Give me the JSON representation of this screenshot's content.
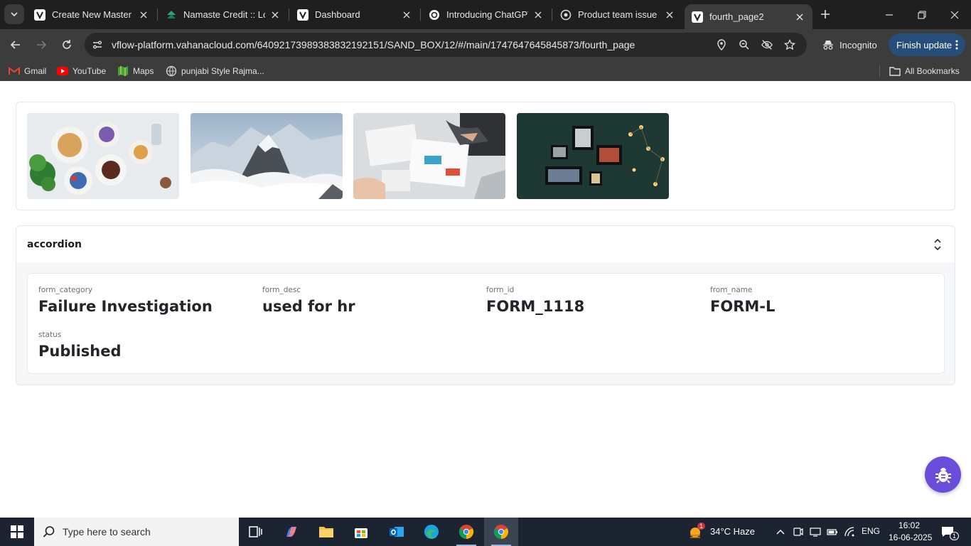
{
  "browser": {
    "tabs": [
      {
        "title": "Create New Master Page",
        "favicon": "vflow-v-icon"
      },
      {
        "title": "Namaste Credit :: Login",
        "favicon": "namaste-credit-icon"
      },
      {
        "title": "Dashboard",
        "favicon": "vflow-v-icon"
      },
      {
        "title": "Introducing ChatGPT",
        "favicon": "chatgpt-icon"
      },
      {
        "title": "Product team issue",
        "favicon": "chatgpt-icon"
      },
      {
        "title": "fourth_page2",
        "favicon": "vflow-v-icon",
        "active": true
      }
    ],
    "url": "vflow-platform.vahanacloud.com/64092173989383832192151/SAND_BOX/12/#/main/1747647645845873/fourth_page",
    "incognito_label": "Incognito",
    "finish_update_label": "Finish update",
    "bookmarks": [
      {
        "label": "Gmail",
        "icon": "gmail-icon"
      },
      {
        "label": "YouTube",
        "icon": "youtube-icon"
      },
      {
        "label": "Maps",
        "icon": "maps-icon"
      },
      {
        "label": "punjabi Style Rajma...",
        "icon": "globe-icon"
      }
    ],
    "all_bookmarks_label": "All Bookmarks"
  },
  "gallery": {
    "images": [
      {
        "subject": "breakfast table"
      },
      {
        "subject": "snowy mountain peak"
      },
      {
        "subject": "team reviewing documents"
      },
      {
        "subject": "picture frames on dark wall"
      }
    ]
  },
  "accordion": {
    "title": "accordion",
    "fields": [
      {
        "label": "form_category",
        "value": "Failure Investigation"
      },
      {
        "label": "form_desc",
        "value": "used for hr"
      },
      {
        "label": "form_id",
        "value": "FORM_1118"
      },
      {
        "label": "from_name",
        "value": "FORM-L"
      },
      {
        "label": "status",
        "value": "Published"
      }
    ]
  },
  "taskbar": {
    "search_placeholder": "Type here to search",
    "weather": "34°C  Haze",
    "weather_badge": "1",
    "language": "ENG",
    "time": "16:02",
    "date": "16-06-2025",
    "notification_count": "1"
  },
  "colors": {
    "accent_purple": "#6a4ddb",
    "finish_update_bg": "#254f7a",
    "tab_bg": "#1f1f1f",
    "toolbar_bg": "#3c3c3c"
  }
}
